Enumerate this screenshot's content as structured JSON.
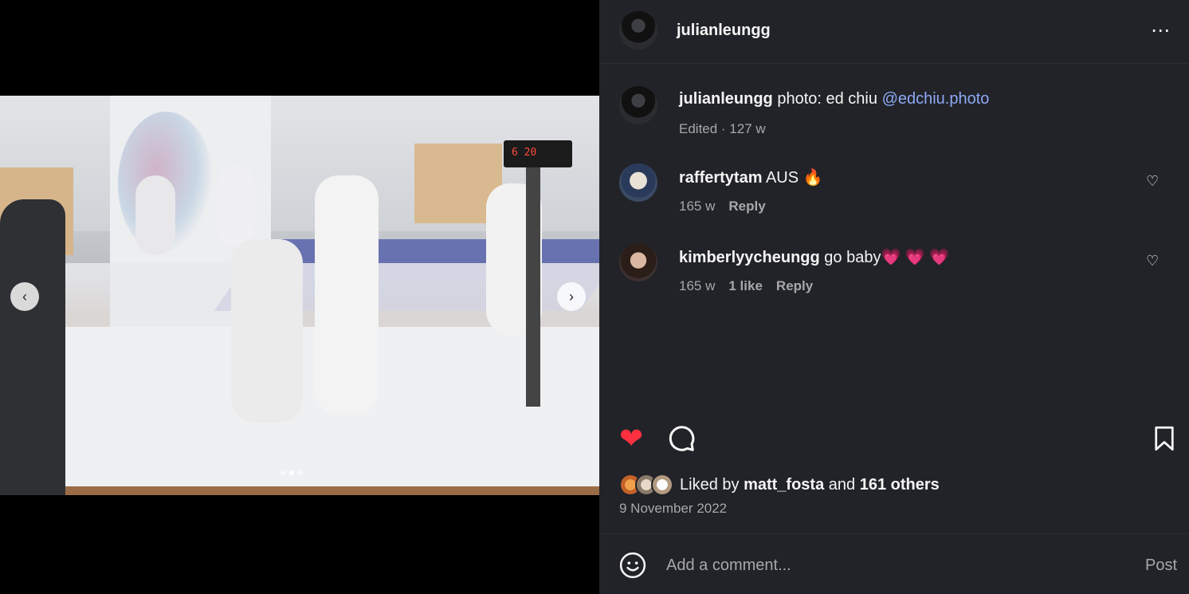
{
  "post": {
    "author": "julianleungg",
    "more_icon": "⋯",
    "media": {
      "prev_icon": "‹",
      "next_icon": "›",
      "scoreboard": "6  20",
      "carousel_count": 3,
      "carousel_active_index": 1
    },
    "caption": {
      "username": "julianleungg",
      "text": "photo: ed chiu",
      "mention": "@edchiu.photo",
      "meta": "Edited · 127 w"
    },
    "comments": [
      {
        "username": "raffertytam",
        "text": "AUS 🔥",
        "age": "165 w",
        "likes": "",
        "reply_label": "Reply"
      },
      {
        "username": "kimberlyycheungg",
        "text": "go baby💗 💗 💗",
        "age": "165 w",
        "likes": "1 like",
        "reply_label": "Reply"
      }
    ],
    "actions": {
      "liked": true
    },
    "likes_summary": {
      "prefix": "Liked by",
      "user": "matt_fosta",
      "joiner": "and",
      "others": "161 others"
    },
    "date": "9 November 2022",
    "add_comment": {
      "placeholder": "Add a comment...",
      "post_label": "Post"
    }
  },
  "colors": {
    "panel_bg": "#212328",
    "like_red": "#ff3040",
    "mention_blue": "#8fa9f5",
    "secondary_text": "#a8a8a8"
  }
}
